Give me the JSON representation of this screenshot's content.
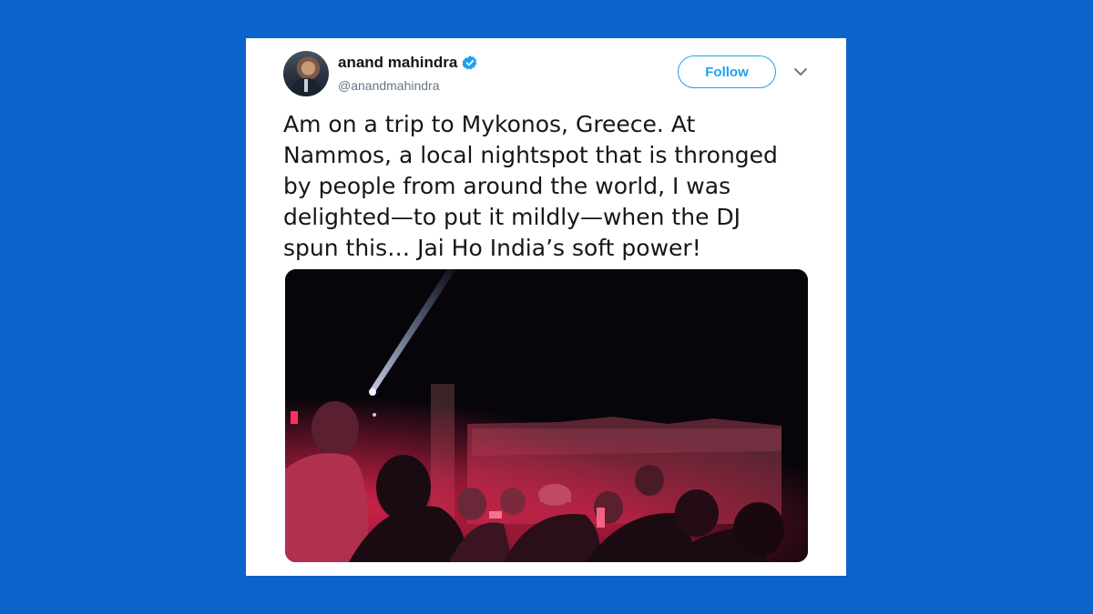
{
  "tweet": {
    "author_name": "anand mahindra",
    "author_handle": "@anandmahindra",
    "verified_icon": "verified-badge-icon",
    "follow_label": "Follow",
    "menu_icon": "chevron-down-icon",
    "text_lines": [
      "Am on a trip to Mykonos, Greece. At",
      "Nammos, a local nightspot that is thronged",
      "by people from around the world, I was",
      "delighted—to put it mildly—when the DJ",
      "spun this… Jai Ho India’s soft power!"
    ]
  },
  "colors": {
    "page_background": "#0b63cc",
    "card_background": "#ffffff",
    "accent": "#1da1f2",
    "text_primary": "#14171a",
    "text_secondary": "#657786"
  }
}
